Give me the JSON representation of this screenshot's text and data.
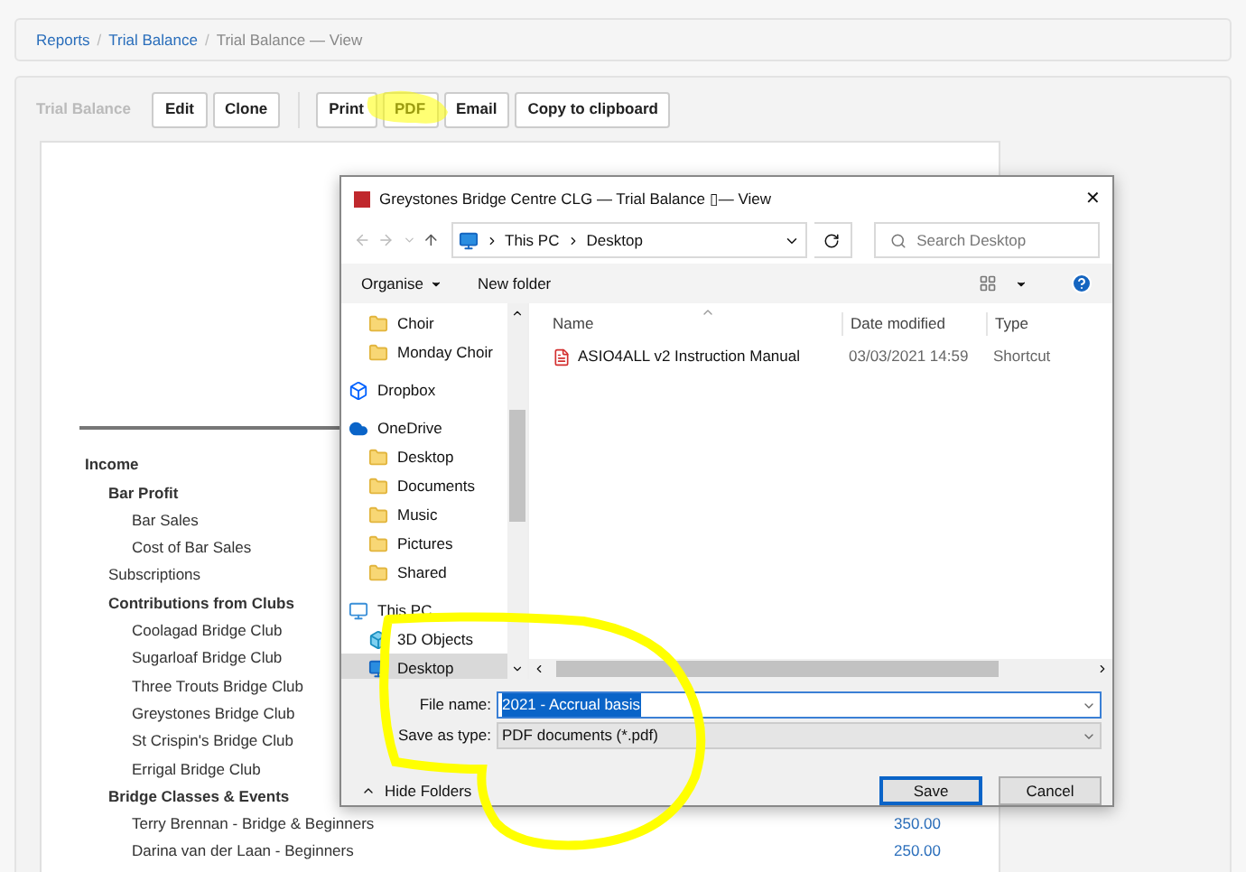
{
  "breadcrumb": [
    {
      "label": "Reports",
      "link": true,
      "separator": "/"
    },
    {
      "label": "Trial Balance",
      "link": true,
      "separator": "/"
    },
    {
      "label": "Trial Balance — View",
      "link": false
    }
  ],
  "toolbar": {
    "title": "Trial Balance",
    "groups": [
      [
        "Edit",
        "Clone"
      ],
      [
        "Print",
        "PDF",
        "Email",
        "Copy to clipboard"
      ]
    ]
  },
  "report": {
    "rows": [
      {
        "label": "Income",
        "children": [
          {
            "label": "Bar Profit",
            "children": [
              {
                "label": "Bar Sales"
              },
              {
                "label": "Cost of Bar Sales"
              }
            ]
          },
          {
            "label": "Subscriptions"
          },
          {
            "label": "Contributions from Clubs",
            "children": [
              {
                "label": "Coolagad Bridge Club"
              },
              {
                "label": "Sugarloaf Bridge Club"
              },
              {
                "label": "Three Trouts Bridge Club"
              },
              {
                "label": "Greystones Bridge Club"
              },
              {
                "label": "St Crispin's Bridge Club"
              },
              {
                "label": "Errigal Bridge Club"
              }
            ]
          },
          {
            "label": "Bridge Classes & Events",
            "children": [
              {
                "label": "Terry Brennan - Bridge & Beginners",
                "amount": "350.00"
              },
              {
                "label": "Darina van der Laan - Beginners",
                "amount": "250.00"
              }
            ]
          }
        ]
      }
    ]
  },
  "dialog": {
    "title": "Greystones Bridge Centre CLG — Trial Balance ▯— View",
    "close": "✕",
    "path": [
      "This PC",
      "Desktop"
    ],
    "search": {
      "placeholder": "Search Desktop"
    },
    "commands": [
      {
        "label": "Organise",
        "menu": true
      },
      {
        "label": "New folder",
        "menu": false
      }
    ],
    "nav": [
      {
        "kind": "continued",
        "children": [
          {
            "label": "Choir",
            "kind": "folder",
            "selected": false
          },
          {
            "label": "Monday Choir",
            "kind": "folder",
            "selected": false
          }
        ]
      },
      {
        "label": "Dropbox",
        "kind": "dropbox",
        "selected": false
      },
      {
        "label": "OneDrive",
        "kind": "onedrive",
        "selected": false,
        "children": [
          {
            "label": "Desktop",
            "kind": "folder",
            "selected": false
          },
          {
            "label": "Documents",
            "kind": "folder",
            "selected": false
          },
          {
            "label": "Music",
            "kind": "folder",
            "selected": false
          },
          {
            "label": "Pictures",
            "kind": "folder",
            "selected": false
          },
          {
            "label": "Shared",
            "kind": "folder",
            "selected": false
          }
        ]
      },
      {
        "label": "This PC",
        "kind": "pc",
        "selected": false,
        "children": [
          {
            "label": "3D Objects",
            "kind": "objects",
            "selected": false
          },
          {
            "label": "Desktop",
            "kind": "desktop",
            "selected": true
          }
        ]
      }
    ],
    "columns": [
      "Name",
      "Date modified",
      "Type"
    ],
    "files": [
      {
        "name": "ASIO4ALL v2 Instruction Manual",
        "date": "03/03/2021 14:59",
        "type": "Shortcut"
      }
    ],
    "file_name": {
      "label": "File name:",
      "value": "2021 - Accrual basis"
    },
    "save_type": {
      "label": "Save as type:",
      "value": "PDF documents (*.pdf)"
    },
    "hide_folders": "Hide Folders",
    "buttons": [
      {
        "label": "Save",
        "default": true
      },
      {
        "label": "Cancel",
        "default": false
      }
    ]
  }
}
